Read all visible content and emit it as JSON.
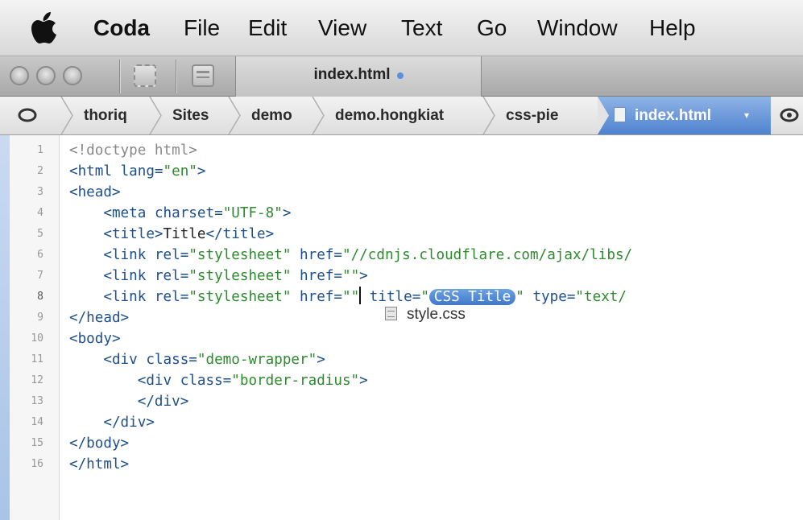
{
  "menubar": {
    "app": "Coda",
    "items": [
      "File",
      "Edit",
      "View",
      "Text",
      "Go",
      "Window",
      "Help"
    ]
  },
  "toolbar": {
    "tab_title": "index.html"
  },
  "path": {
    "crumbs": [
      "thoriq",
      "Sites",
      "demo",
      "demo.hongkiat",
      "css-pie"
    ],
    "active": "index.html"
  },
  "editor": {
    "line_numbers": [
      "1",
      "2",
      "3",
      "4",
      "5",
      "6",
      "7",
      "8",
      "9",
      "10",
      "11",
      "12",
      "13",
      "14",
      "15",
      "16"
    ],
    "lines": {
      "l1": "<!doctype html>",
      "l2_tag": "<html ",
      "l2_attr": "lang=",
      "l2_str": "\"en\"",
      "l2_end": ">",
      "l3": "<head>",
      "l4_tag": "    <meta ",
      "l4_attr": "charset=",
      "l4_str": "\"UTF-8\"",
      "l4_end": ">",
      "l5_tag": "    <title>",
      "l5_txt": "Title",
      "l5_end": "</title>",
      "l6_tag": "    <link ",
      "l6_attr1": "rel=",
      "l6_str1": "\"stylesheet\"",
      "l6_attr2": " href=",
      "l6_str2": "\"//cdnjs.cloudflare.com/ajax/libs/",
      "l7_tag": "    <link ",
      "l7_attr1": "rel=",
      "l7_str1": "\"stylesheet\"",
      "l7_attr2": " href=",
      "l7_str2": "\"\"",
      "l7_end": ">",
      "l8_tag": "    <link ",
      "l8_attr1": "rel=",
      "l8_str1": "\"stylesheet\"",
      "l8_attr2": " href=",
      "l8_str2a": "\"\"",
      "l8_attr3": " title=",
      "l8_q1": "\"",
      "l8_placeholder": "CSS Title",
      "l8_q2": "\"",
      "l8_attr4": " type=",
      "l8_str4": "\"text/",
      "l9": "</head>",
      "l10": "<body>",
      "l11_tag": "    <div ",
      "l11_attr": "class=",
      "l11_str": "\"demo-wrapper\"",
      "l11_end": ">",
      "l12_tag": "        <div ",
      "l12_attr": "class=",
      "l12_str": "\"border-radius\"",
      "l12_end": ">",
      "l13": "        </div>",
      "l14": "    </div>",
      "l15": "</body>",
      "l16": "</html>"
    },
    "autocomplete": "style.css"
  },
  "colors": {
    "tag": "#1d4f8b",
    "string": "#2d8a2d",
    "selection": "#4f82cf"
  }
}
